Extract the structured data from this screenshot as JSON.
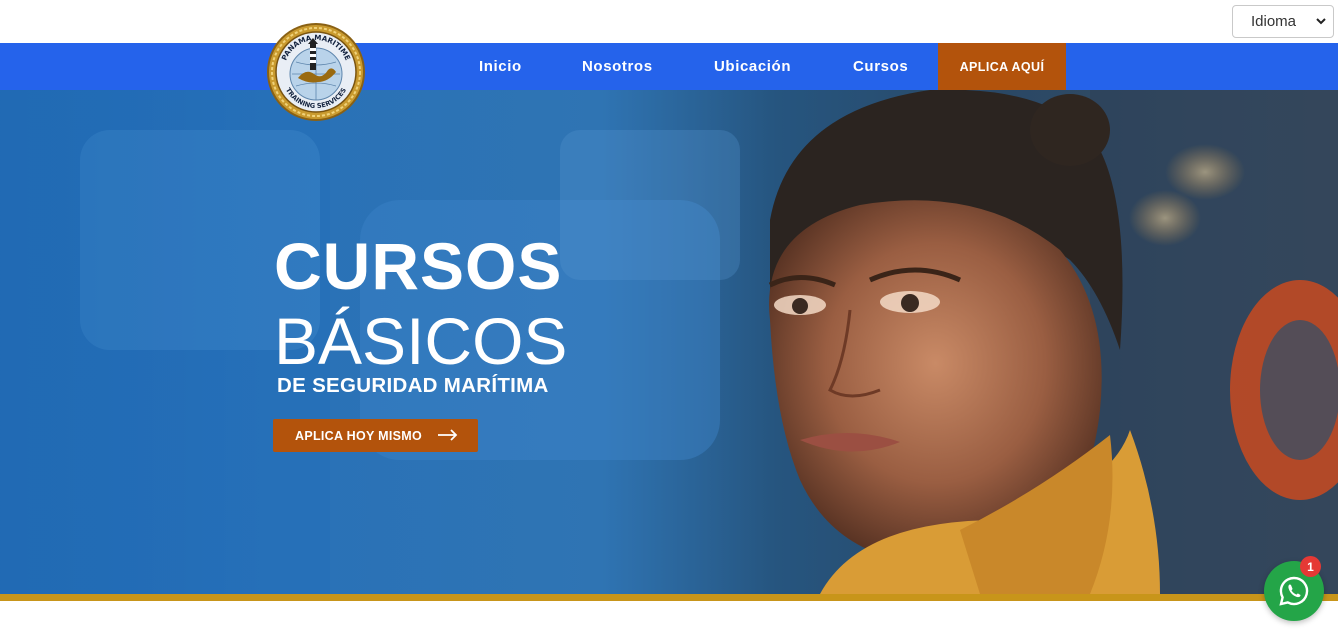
{
  "header": {
    "language_select": {
      "selected": "Idioma",
      "icon": "chevron-down-icon"
    }
  },
  "nav": {
    "items": [
      {
        "label": "Inicio"
      },
      {
        "label": "Nosotros"
      },
      {
        "label": "Ubicación"
      },
      {
        "label": "Cursos"
      }
    ],
    "cta_label": "APLICA AQUÍ",
    "colors": {
      "bar": "#2563eb",
      "cta": "#b3530c"
    }
  },
  "logo": {
    "text_top": "PANAMA MARITIME",
    "text_bottom": "TRAINING SERVICES"
  },
  "hero": {
    "title_line1": "CURSOS",
    "title_line2": "BÁSICOS",
    "subtitle": "DE SEGURIDAD MARÍTIMA",
    "button_label": "APLICA HOY MISMO",
    "button_icon": "arrow-right-icon",
    "accent_border": "#c8951a"
  },
  "whatsapp": {
    "badge_count": "1",
    "icon": "whatsapp-icon"
  }
}
